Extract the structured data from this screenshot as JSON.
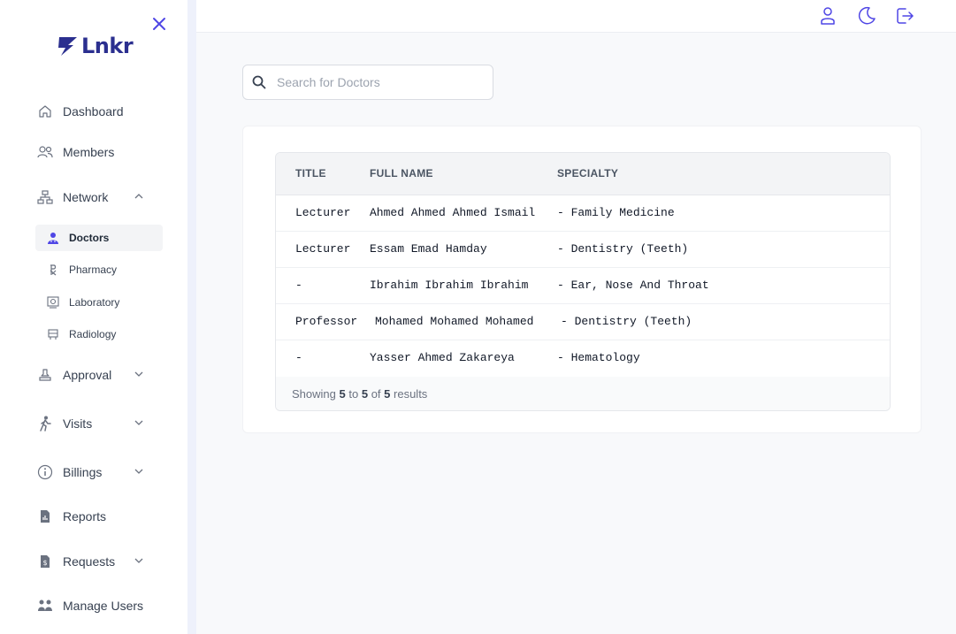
{
  "brand": {
    "logo_text": "Lnkr"
  },
  "sidebar": {
    "items": [
      {
        "label": "Dashboard",
        "icon": "home-icon"
      },
      {
        "label": "Members",
        "icon": "members-icon"
      },
      {
        "label": "Network",
        "icon": "network-icon",
        "expanded": true,
        "children": [
          {
            "label": "Doctors",
            "icon": "doctor-icon",
            "active": true
          },
          {
            "label": "Pharmacy",
            "icon": "pharmacy-icon"
          },
          {
            "label": "Laboratory",
            "icon": "laboratory-icon"
          },
          {
            "label": "Radiology",
            "icon": "radiology-icon"
          }
        ]
      },
      {
        "label": "Approval",
        "icon": "approval-icon",
        "expanded": false
      },
      {
        "label": "Visits",
        "icon": "walking-icon",
        "expanded": false
      },
      {
        "label": "Billings",
        "icon": "info-circle-icon",
        "expanded": false
      },
      {
        "label": "Reports",
        "icon": "report-icon"
      },
      {
        "label": "Requests",
        "icon": "requests-icon",
        "expanded": false
      },
      {
        "label": "Manage Users",
        "icon": "users-icon"
      }
    ]
  },
  "header": {
    "icons": [
      "user-icon",
      "moon-icon",
      "logout-icon"
    ]
  },
  "search": {
    "placeholder": "Search for Doctors",
    "value": ""
  },
  "table": {
    "columns": [
      "TITLE",
      "FULL NAME",
      "SPECIALTY"
    ],
    "rows": [
      {
        "title": "Lecturer",
        "full_name": "Ahmed Ahmed Ahmed Ismail",
        "specialty": "- Family Medicine"
      },
      {
        "title": "Lecturer",
        "full_name": "Essam Emad Hamday",
        "specialty": "- Dentistry (Teeth)"
      },
      {
        "title": "-",
        "full_name": "Ibrahim Ibrahim Ibrahim",
        "specialty": "- Ear, Nose And Throat"
      },
      {
        "title": "Professor",
        "full_name": "Mohamed Mohamed Mohamed",
        "specialty": "- Dentistry (Teeth)"
      },
      {
        "title": "-",
        "full_name": "Yasser Ahmed Zakareya",
        "specialty": "- Hematology"
      }
    ],
    "footer": {
      "prefix": "Showing",
      "from": "5",
      "to_word": "to",
      "to": "5",
      "of_word": "of",
      "total": "5",
      "suffix": "results"
    }
  },
  "colors": {
    "accent": "#4f46e5",
    "brand": "#2b2f8f",
    "sidebar_edge": "#eef1fb",
    "page_bg": "#f8f9fb"
  }
}
